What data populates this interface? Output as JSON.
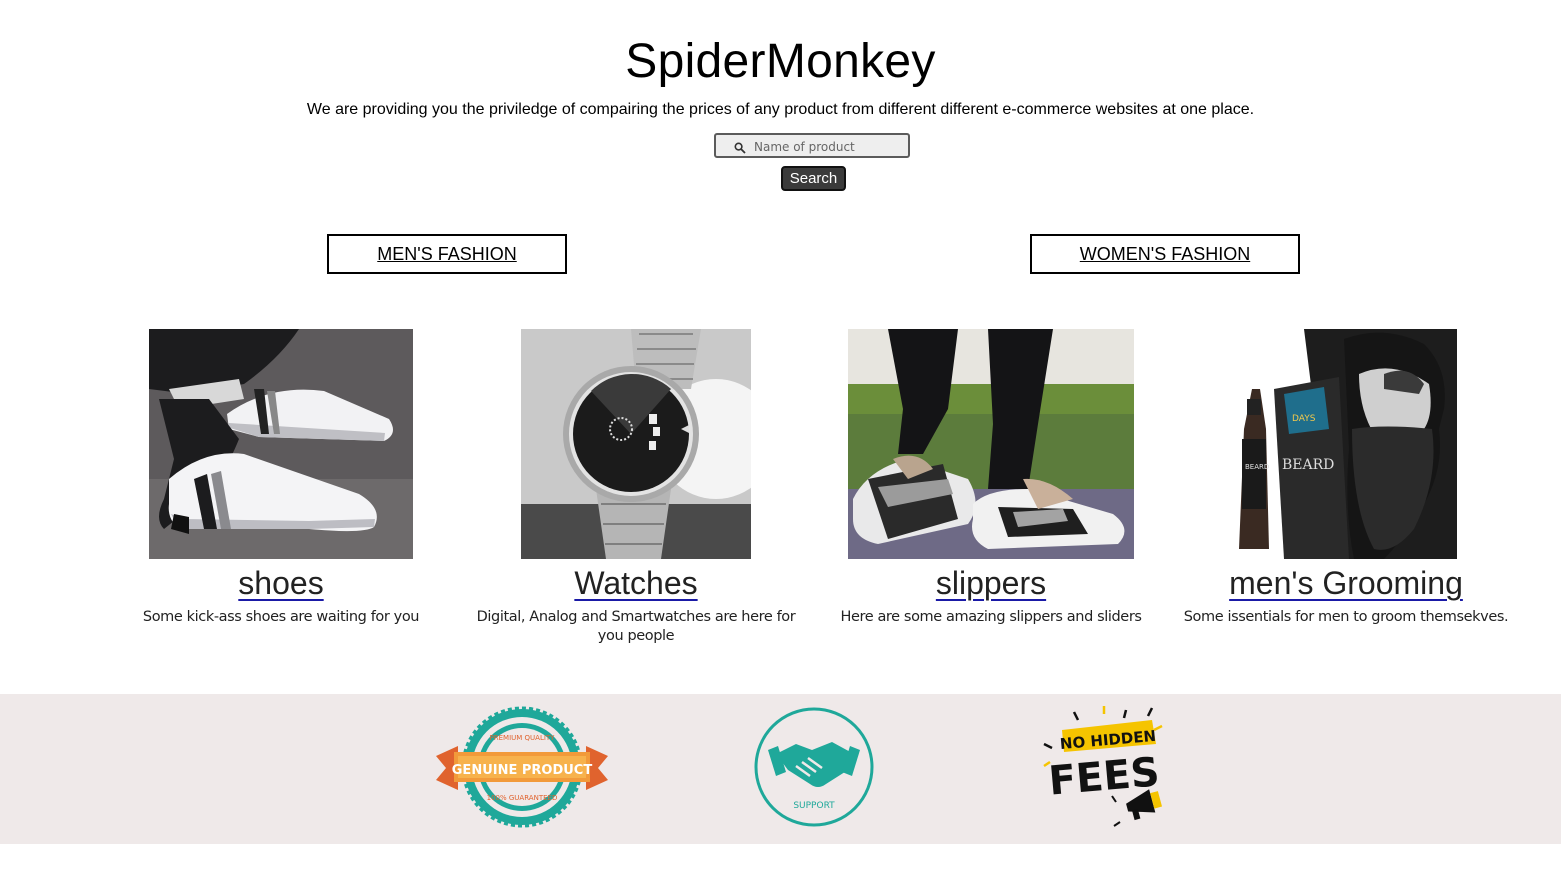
{
  "header": {
    "title": "SpiderMonkey",
    "tagline": "We are providing you the priviledge of compairing the prices of any product from different different e-commerce websites at one place."
  },
  "search": {
    "placeholder": "Name of product",
    "value": "",
    "button_label": "Search",
    "icon": "search-icon"
  },
  "categories": [
    {
      "label": "MEN'S FASHION"
    },
    {
      "label": "WOMEN'S FASHION"
    }
  ],
  "products": [
    {
      "title": "shoes",
      "description": "Some kick-ass shoes are waiting for you",
      "image": "white-sneakers-photo"
    },
    {
      "title": "Watches",
      "description": "Digital, Analog and Smartwatches are here for you people",
      "image": "wristwatch-photo"
    },
    {
      "title": "slippers",
      "description": "Here are some amazing slippers and sliders",
      "image": "slippers-photo"
    },
    {
      "title": "men's Grooming",
      "description": "Some issentials for men to groom themsekves.",
      "image": "beard-oil-photo"
    }
  ],
  "footer": {
    "badges": [
      {
        "name": "genuine-product-badge",
        "main": "GENUINE PRODUCT",
        "top": "PREMIUM QUALITY",
        "bottom": "100% GUARANTEED"
      },
      {
        "name": "support-badge",
        "label": "SUPPORT"
      },
      {
        "name": "no-hidden-fees-badge",
        "line1": "NO HIDDEN",
        "line2": "FEES"
      }
    ]
  },
  "colors": {
    "footer_bg": "#efe9e9",
    "badge_teal": "#1fa89a",
    "badge_orange": "#f29a3a",
    "fees_yellow": "#f5c400"
  }
}
